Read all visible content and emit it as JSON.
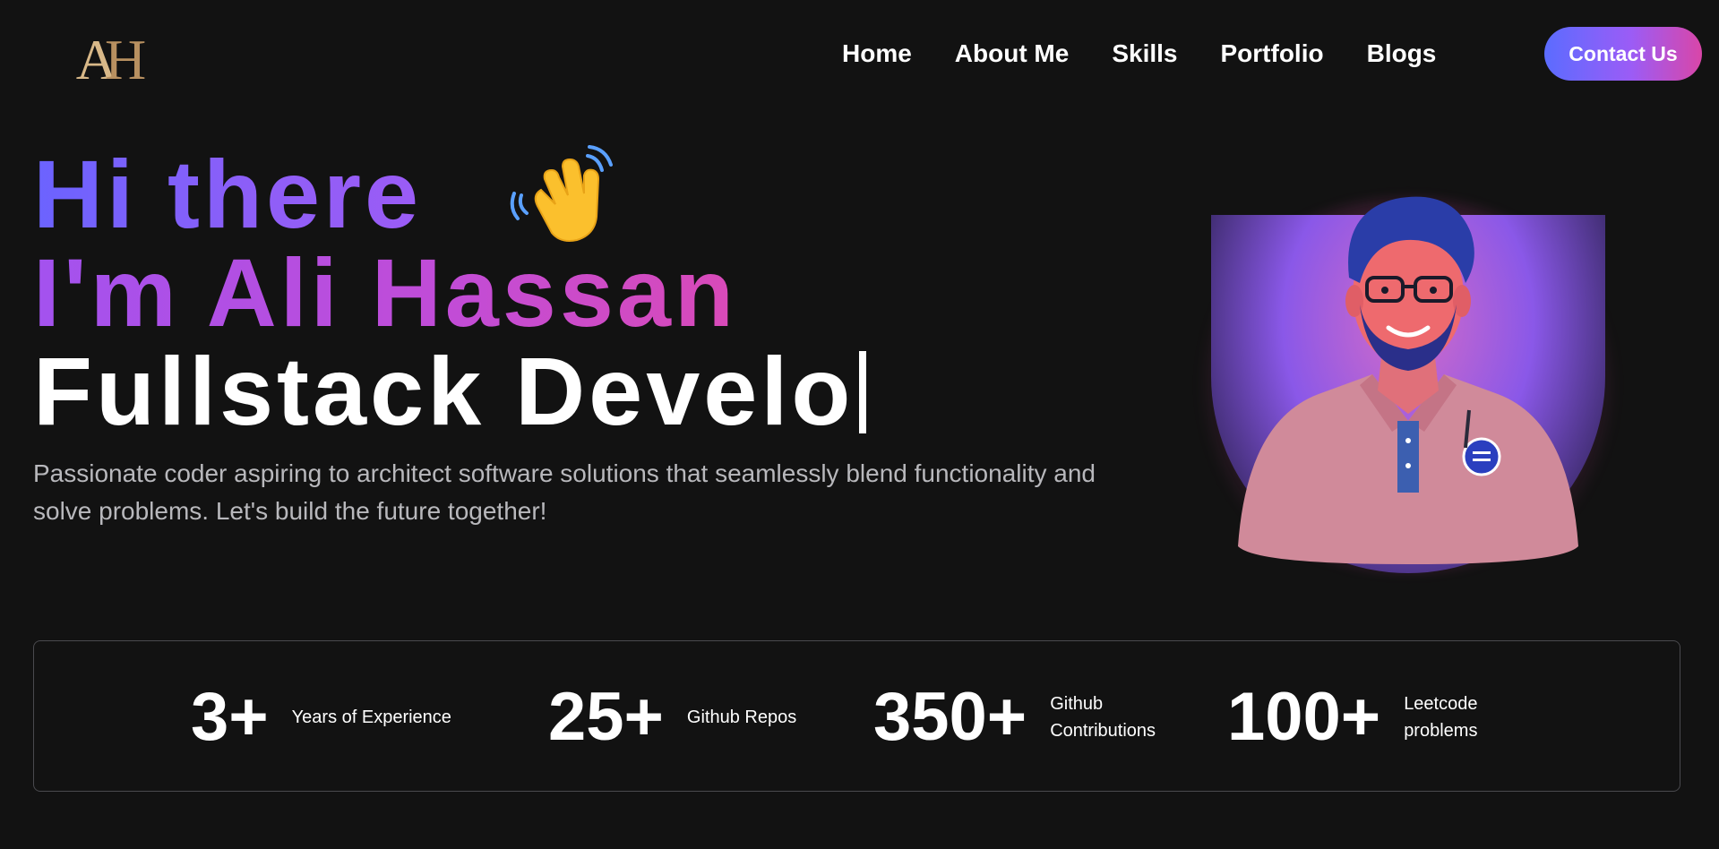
{
  "logo": {
    "monogram_a": "A",
    "monogram_h": "H"
  },
  "nav": {
    "items": [
      {
        "label": "Home"
      },
      {
        "label": "About Me"
      },
      {
        "label": "Skills"
      },
      {
        "label": "Portfolio"
      },
      {
        "label": "Blogs"
      }
    ],
    "cta_label": "Contact Us"
  },
  "hero": {
    "greeting": "Hi there",
    "wave_icon": "waving-hand-icon",
    "name_line": "I'm Ali Hassan",
    "typed_text": "Fullstack Develo",
    "description": "Passionate coder aspiring to architect software solutions that seamlessly blend functionality and solve problems. Let's build the future together!"
  },
  "stats": [
    {
      "value": "3+",
      "label": "Years of Experience"
    },
    {
      "value": "25+",
      "label": "Github Repos"
    },
    {
      "value": "350+",
      "label": "Github Contributions"
    },
    {
      "value": "100+",
      "label": "Leetcode problems"
    }
  ],
  "colors": {
    "background": "#121212",
    "accent_blue": "#5b6cff",
    "accent_purple": "#9b5cf6",
    "accent_pink": "#d946a8",
    "muted_text": "#b8b8bc"
  }
}
